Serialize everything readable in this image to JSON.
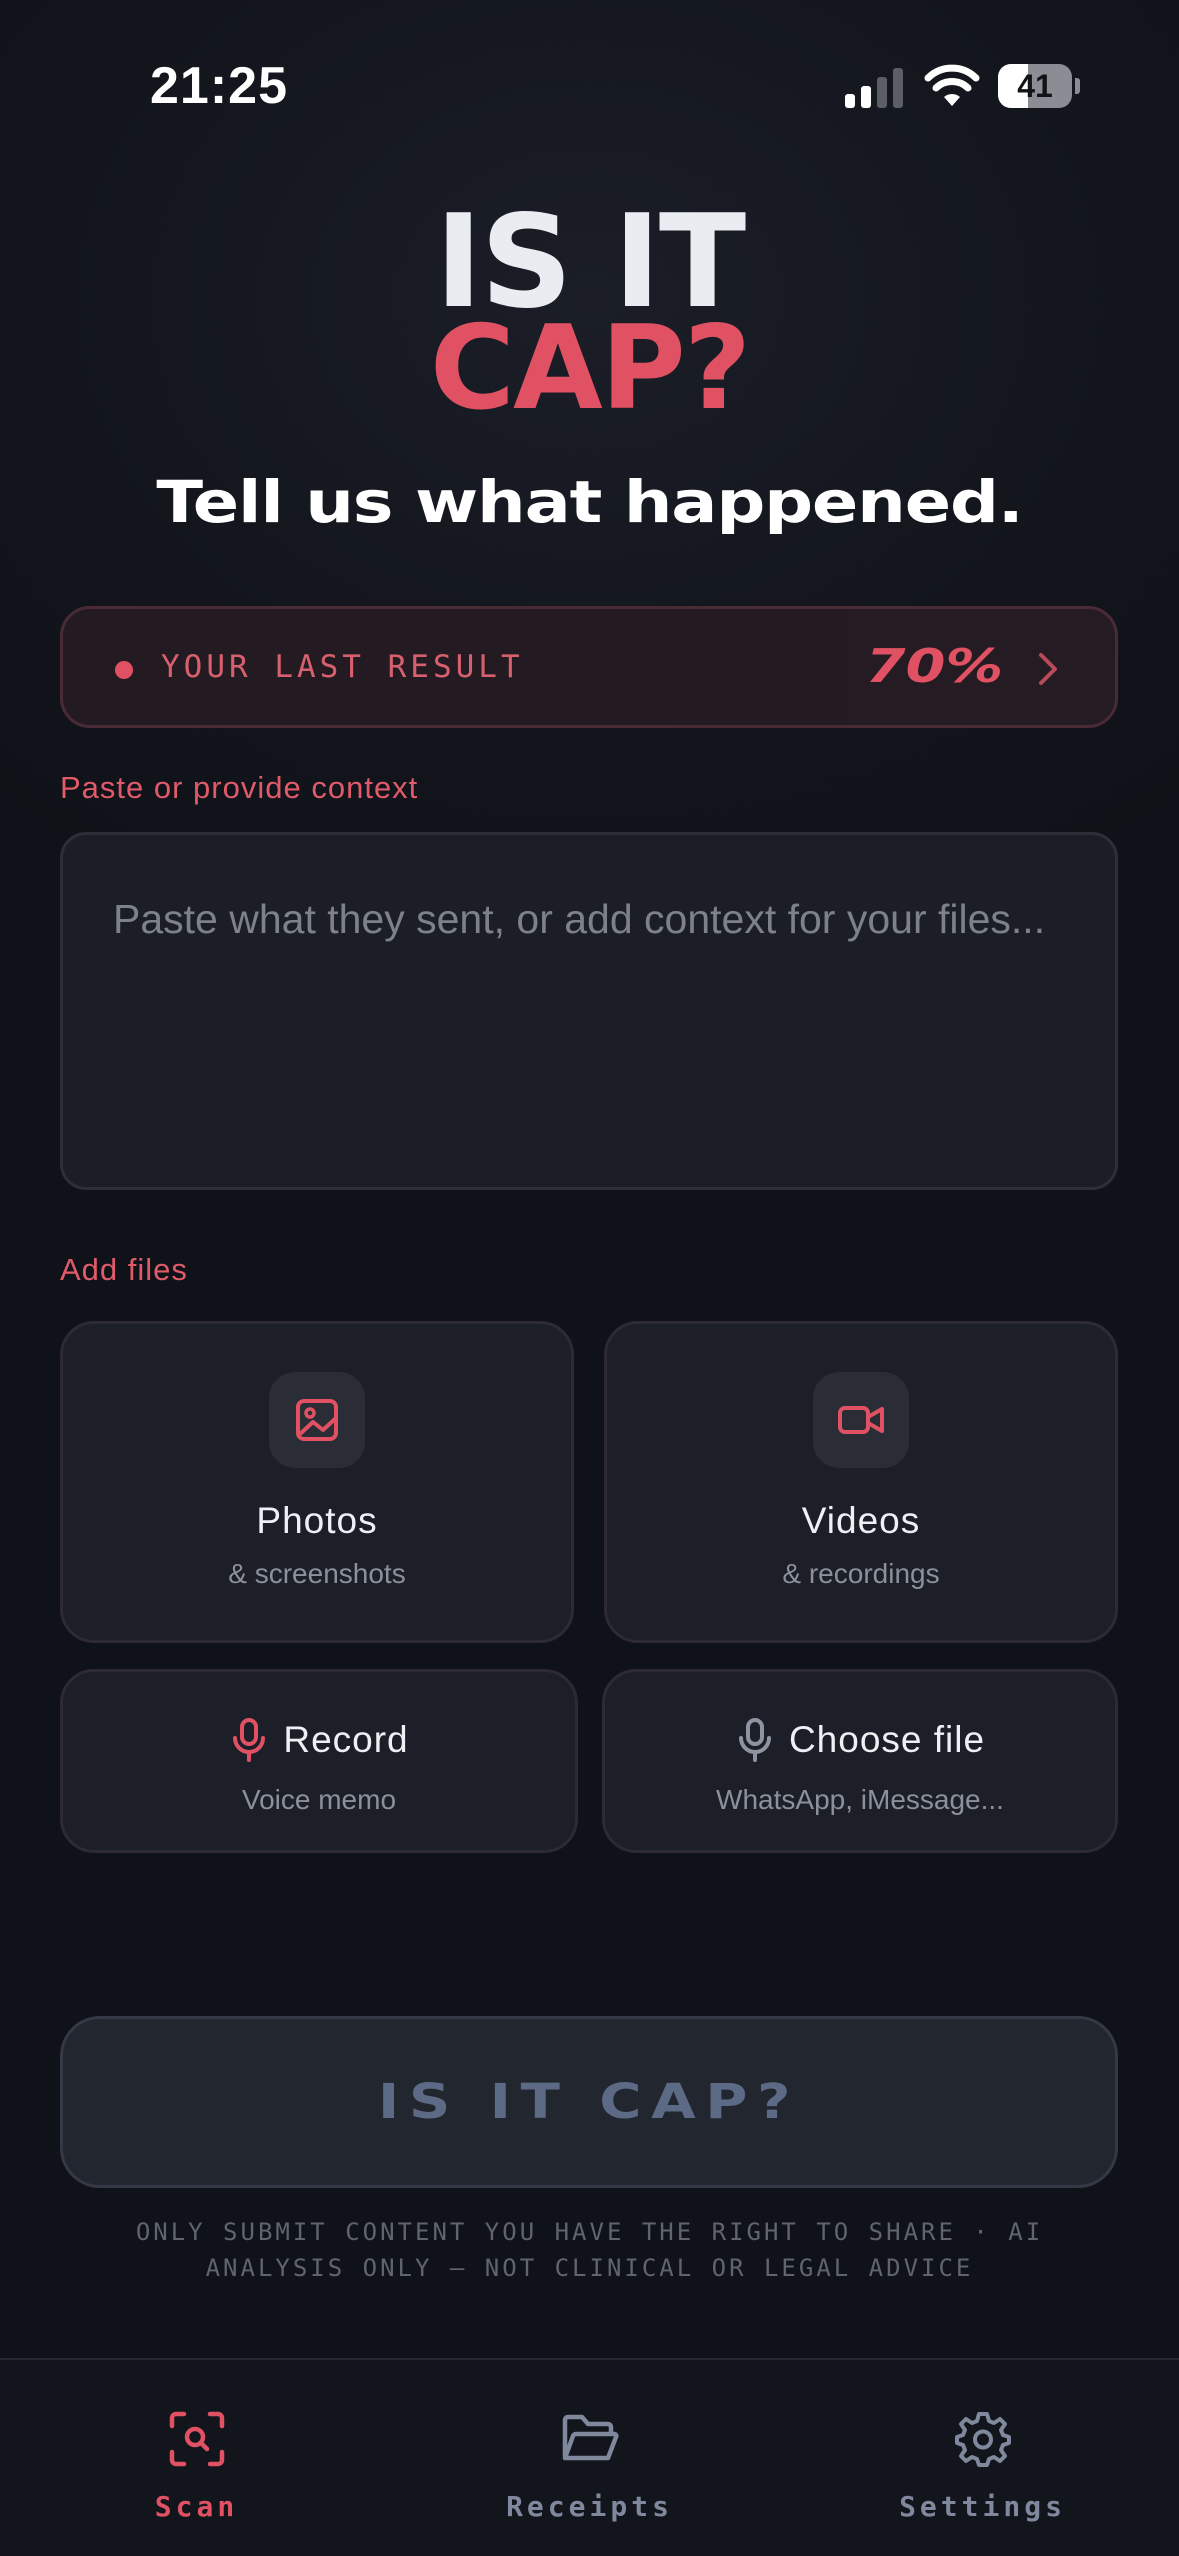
{
  "status_bar": {
    "time": "21:25",
    "battery_level": "41",
    "battery_fraction": 0.41
  },
  "logo": {
    "line1": "IS IT",
    "line2": "CAP?"
  },
  "headline": "Tell us what happened.",
  "last_result": {
    "label": "YOUR LAST RESULT",
    "value": "70%"
  },
  "context_section": {
    "label": "Paste or provide context",
    "placeholder": "Paste what they sent, or add context for your files..."
  },
  "files_section": {
    "label": "Add files",
    "photos": {
      "title": "Photos",
      "subtitle": "& screenshots",
      "icon": "image-icon"
    },
    "videos": {
      "title": "Videos",
      "subtitle": "& recordings",
      "icon": "video-icon"
    },
    "record": {
      "title": "Record",
      "subtitle": "Voice memo",
      "icon": "microphone-icon"
    },
    "choose_file": {
      "title": "Choose file",
      "subtitle": "WhatsApp, iMessage...",
      "icon": "microphone-icon"
    }
  },
  "submit": {
    "label": "IS IT CAP?"
  },
  "disclaimer": "ONLY SUBMIT CONTENT YOU HAVE THE RIGHT TO SHARE · AI ANALYSIS ONLY — NOT CLINICAL OR LEGAL ADVICE",
  "nav": {
    "items": [
      {
        "label": "Scan",
        "icon": "scan-icon",
        "active": true
      },
      {
        "label": "Receipts",
        "icon": "folder-icon",
        "active": false
      },
      {
        "label": "Settings",
        "icon": "gear-icon",
        "active": false
      }
    ]
  },
  "colors": {
    "accent": "#e05263",
    "background": "#12151c",
    "card": "#1c1f27",
    "muted": "#8b909a",
    "nav_inactive": "#7f889c"
  }
}
